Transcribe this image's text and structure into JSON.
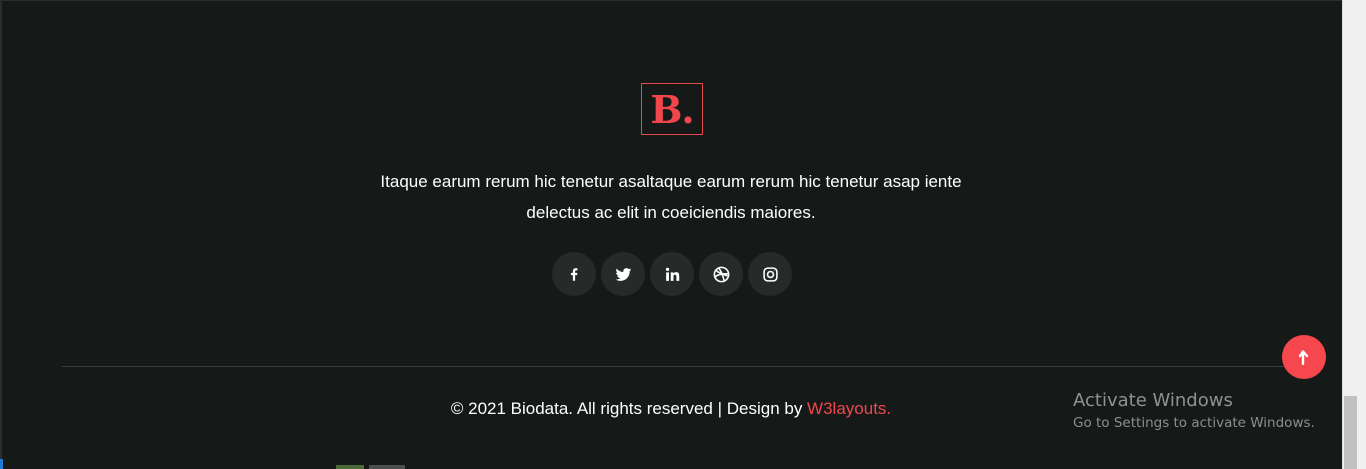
{
  "footer": {
    "logo_text": "B.",
    "tagline_line1": "Itaque earum rerum hic tenetur asaltaque earum rerum hic tenetur asap iente",
    "tagline_line2": "delectus ac elit in coeiciendis maiores.",
    "social": [
      {
        "name": "facebook-icon"
      },
      {
        "name": "twitter-icon"
      },
      {
        "name": "linkedin-icon"
      },
      {
        "name": "dribbble-icon"
      },
      {
        "name": "instagram-icon"
      }
    ],
    "copyright_prefix": "© 2021 Biodata. All rights reserved | Design by ",
    "copyright_link": "W3layouts."
  },
  "back_to_top": {
    "icon": "arrow-up-icon"
  },
  "windows_watermark": {
    "title": "Activate Windows",
    "subtitle": "Go to Settings to activate Windows."
  },
  "colors": {
    "background": "#151a19",
    "accent": "#f0464c",
    "social_bg": "#262b2a"
  }
}
